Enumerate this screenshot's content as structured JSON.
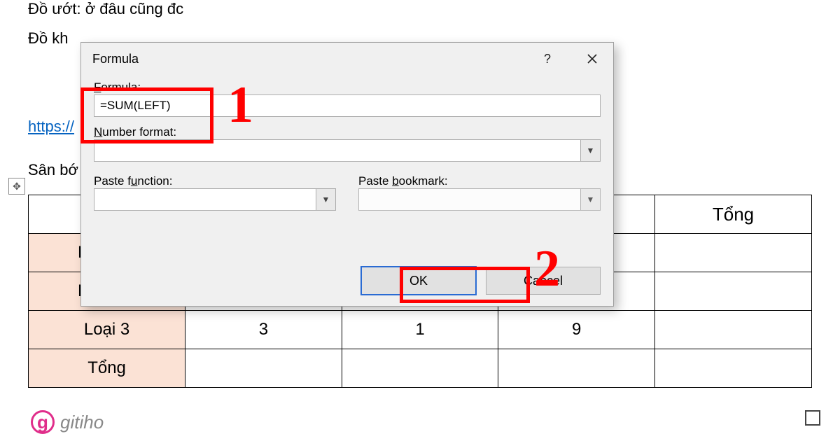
{
  "document": {
    "line1": "Đồ ướt: ở đâu cũng đc",
    "line2": "Đồ kh",
    "link_fragment": "https://",
    "line3": "Sân bớ"
  },
  "table": {
    "header_last": "Tổng",
    "rows": [
      {
        "label": "L"
      },
      {
        "label": "L"
      },
      {
        "label": "Loại 3",
        "c1": "3",
        "c2": "1",
        "c3": "9",
        "c4": ""
      },
      {
        "label": "Tổng",
        "c1": "",
        "c2": "",
        "c3": "",
        "c4": ""
      }
    ]
  },
  "dialog": {
    "title": "Formula",
    "labels": {
      "formula": "Formula:",
      "number_format": "Number format:",
      "paste_function": "Paste function:",
      "paste_bookmark": "Paste bookmark:"
    },
    "fields": {
      "formula": "=SUM(LEFT)",
      "number_format": "",
      "paste_function": "",
      "paste_bookmark": ""
    },
    "buttons": {
      "ok": "OK",
      "cancel": "Cancel"
    },
    "help_tooltip": "?"
  },
  "annotations": {
    "marker1": "1",
    "marker2": "2"
  },
  "watermark": "gitiho"
}
